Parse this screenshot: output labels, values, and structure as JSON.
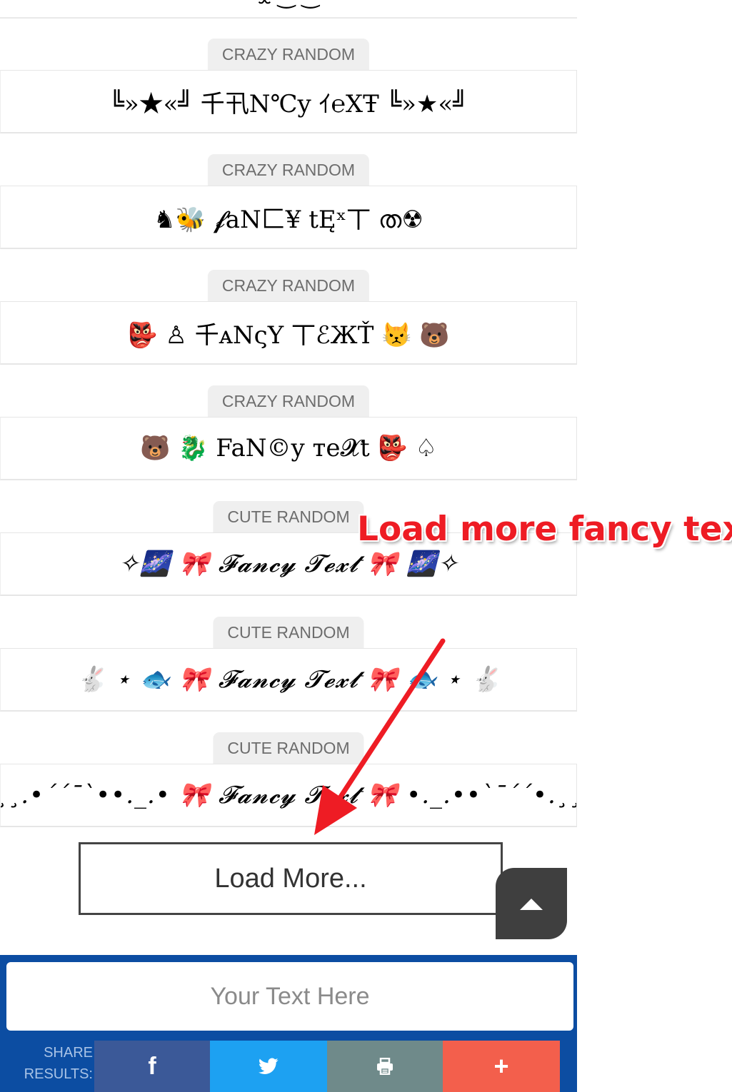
{
  "top_partial_text": "ᴥ ‿ ‿",
  "entries": [
    {
      "tag": "CRAZY RANDOM",
      "text": "╚»★«╝ 千卂N℃y ｲ℮XŦ ╚»★«╝"
    },
    {
      "tag": "CRAZY RANDOM",
      "text": "♞🐝 𝓯aN匚¥ tĘˣ丅 ത☢"
    },
    {
      "tag": "CRAZY RANDOM",
      "text": "👺 ♙ 千ᴀNςY 丅ℰЖŤ 😾 🐻"
    },
    {
      "tag": "CRAZY RANDOM",
      "text": "🐻 🐉 FaN©y ᴛe𝓧t 👺 ♤"
    },
    {
      "tag": "CUTE RANDOM",
      "text": "✧🌌 🎀 𝓕𝓪𝓷𝓬𝔂 𝓣𝓮𝔁𝓽 🎀 🌌✧"
    },
    {
      "tag": "CUTE RANDOM",
      "text": "🐇 ⋆ 🐟 🎀 𝓕𝓪𝓷𝓬𝔂 𝓣𝓮𝔁𝓽 🎀 🐟 ⋆ 🐇"
    },
    {
      "tag": "CUTE RANDOM",
      "text": "`•.¸¸.•´´¯`••._.• 🎀 𝓕𝓪𝓷𝓬𝔂 𝓣𝓮𝔁𝓽 🎀 •._.••`¯´´•.¸¸.•`"
    }
  ],
  "load_more_label": "Load More...",
  "annotation_text": "Load more fancy text",
  "input": {
    "placeholder": "Your Text Here",
    "value": ""
  },
  "share": {
    "label_line1": "SHARE",
    "label_line2": "RESULTS:",
    "buttons": [
      {
        "icon": "facebook-icon",
        "glyph": "f",
        "color": "#3b5998"
      },
      {
        "icon": "twitter-icon",
        "color": "#1da1f2"
      },
      {
        "icon": "print-icon",
        "color": "#6f8a8a"
      },
      {
        "icon": "plus-icon",
        "glyph": "+",
        "color": "#f35f4c"
      }
    ]
  },
  "colors": {
    "footer": "#0c4da2",
    "annotation": "#ee1c24",
    "scroll_top": "#3f3f3f"
  }
}
